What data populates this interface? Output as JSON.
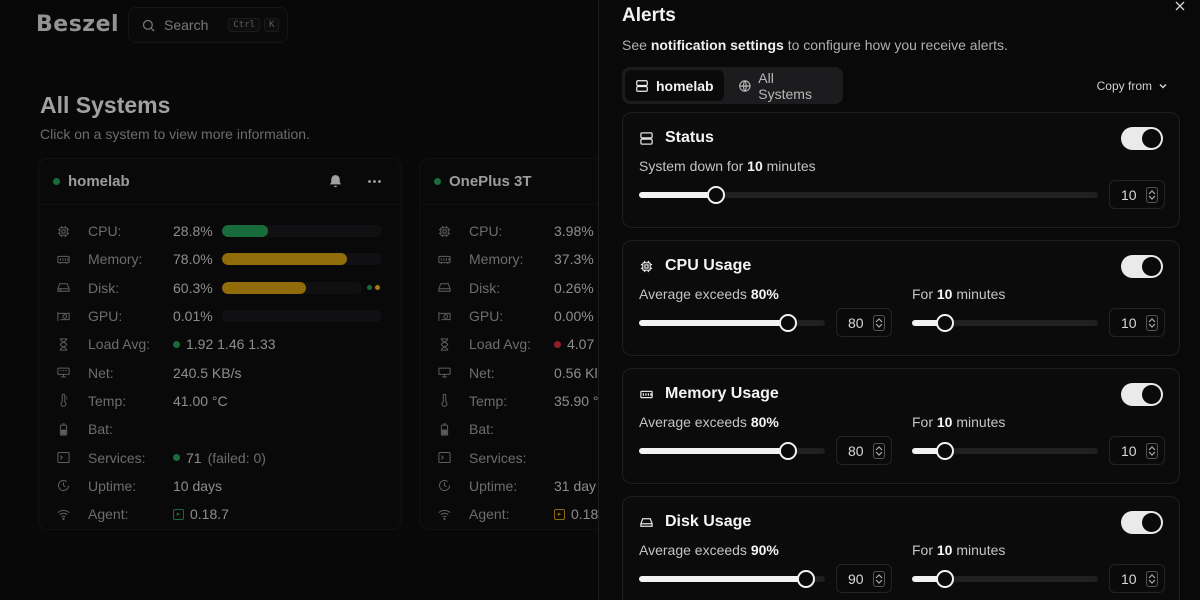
{
  "app": {
    "logo": "Beszel"
  },
  "search": {
    "label": "Search",
    "kbd": [
      "Ctrl",
      "K"
    ]
  },
  "page": {
    "title": "All Systems",
    "subtitle": "Click on a system to view more information."
  },
  "labels": {
    "cpu": "CPU:",
    "memory": "Memory:",
    "disk": "Disk:",
    "gpu": "GPU:",
    "load": "Load Avg:",
    "net": "Net:",
    "temp": "Temp:",
    "bat": "Bat:",
    "services": "Services:",
    "uptime": "Uptime:",
    "agent": "Agent:"
  },
  "systems": [
    {
      "name": "homelab",
      "status_color": "#1d8a4b",
      "cpu": "28.8%",
      "cpu_pct": 0.288,
      "cpu_color": "#1f8a4c",
      "memory": "78.0%",
      "memory_pct": 0.78,
      "memory_color": "#b88a0e",
      "disk": "60.3%",
      "disk_pct": 0.603,
      "disk_color": "#b88a0e",
      "gpu": "0.01%",
      "gpu_pct": 0.0001,
      "load": "1.92 1.46 1.33",
      "net": "240.5 KB/s",
      "temp": "41.00 °C",
      "bat": "",
      "services": "71",
      "services_failed": "(failed: 0)",
      "uptime": "10 days",
      "agent": "0.18.7",
      "agent_color": "#1f8a4c"
    },
    {
      "name": "OnePlus 3T",
      "status_color": "#1d8a4b",
      "cpu": "3.98%",
      "memory": "37.3%",
      "disk": "0.26%",
      "gpu": "0.00%",
      "load": "4.07",
      "net": "0.56 Kl",
      "temp": "35.90 °",
      "bat": "",
      "services": "",
      "uptime": "31 day",
      "agent": "0.18",
      "agent_color": "#b8860b"
    }
  ],
  "alerts": {
    "title": "Alerts",
    "subtitle_pre": "See ",
    "subtitle_link": "notification settings",
    "subtitle_post": " to configure how you receive alerts.",
    "tabs": [
      {
        "label": "homelab",
        "active": true
      },
      {
        "label": "All Systems",
        "active": false
      }
    ],
    "copy_from": "Copy from",
    "items": [
      {
        "title": "Status",
        "enabled": true,
        "desc1_pre": "System down for ",
        "desc1_bold": "10",
        "desc1_post": " minutes",
        "value1": "10",
        "value1_pct": 0.167
      },
      {
        "title": "CPU Usage",
        "enabled": true,
        "desc1_pre": "Average exceeds ",
        "desc1_bold": "80%",
        "desc1_post": "",
        "value1": "80",
        "value1_pct": 0.8,
        "desc2_pre": "For ",
        "desc2_bold": "10",
        "desc2_post": " minutes",
        "value2": "10",
        "value2_pct": 0.18
      },
      {
        "title": "Memory Usage",
        "enabled": true,
        "desc1_pre": "Average exceeds ",
        "desc1_bold": "80%",
        "desc1_post": "",
        "value1": "80",
        "value1_pct": 0.8,
        "desc2_pre": "For ",
        "desc2_bold": "10",
        "desc2_post": " minutes",
        "value2": "10",
        "value2_pct": 0.18
      },
      {
        "title": "Disk Usage",
        "enabled": true,
        "desc1_pre": "Average exceeds ",
        "desc1_bold": "90%",
        "desc1_post": "",
        "value1": "90",
        "value1_pct": 0.9,
        "desc2_pre": "For ",
        "desc2_bold": "10",
        "desc2_post": " minutes",
        "value2": "10",
        "value2_pct": 0.18
      }
    ]
  }
}
